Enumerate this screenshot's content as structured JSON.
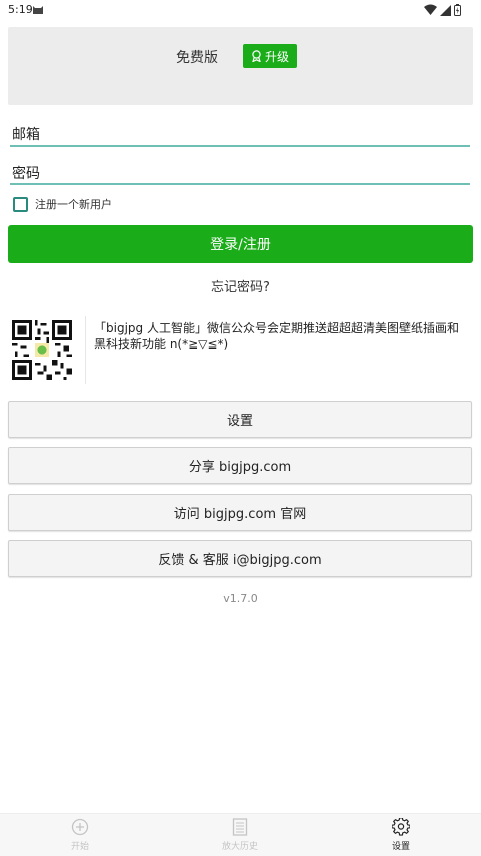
{
  "status_bar": {
    "time": "5:19",
    "icons": [
      "cat-notification-icon",
      "wifi-icon",
      "cell-signal-icon",
      "battery-icon"
    ]
  },
  "plan": {
    "label": "免费版",
    "upgrade_label": "升级",
    "upgrade_icon": "award-icon"
  },
  "form": {
    "email_placeholder": "邮箱",
    "password_placeholder": "密码",
    "register_checkbox_label": "注册一个新用户",
    "login_button": "登录/注册",
    "forgot_password": "忘记密码?"
  },
  "promo": {
    "qr_icon": "qr-code-icon",
    "text": "「bigjpg 人工智能」微信公众号会定期推送超超超清美图壁纸插画和黑科技新功能 n(*≧▽≦*)"
  },
  "menu": {
    "settings": "设置",
    "share": "分享 bigjpg.com",
    "visit": "访问 bigjpg.com 官网",
    "feedback": "反馈 & 客服 i@bigjpg.com"
  },
  "version": "v1.7.0",
  "bottom_nav": {
    "items": [
      {
        "label": "开始",
        "icon": "plus-circle-icon",
        "active": false
      },
      {
        "label": "放大历史",
        "icon": "list-document-icon",
        "active": false
      },
      {
        "label": "设置",
        "icon": "gear-icon",
        "active": true
      }
    ]
  },
  "colors": {
    "brand_green": "#1aad19",
    "input_underline": "#6fbfb5",
    "checkbox_border": "#2a8a7e"
  }
}
